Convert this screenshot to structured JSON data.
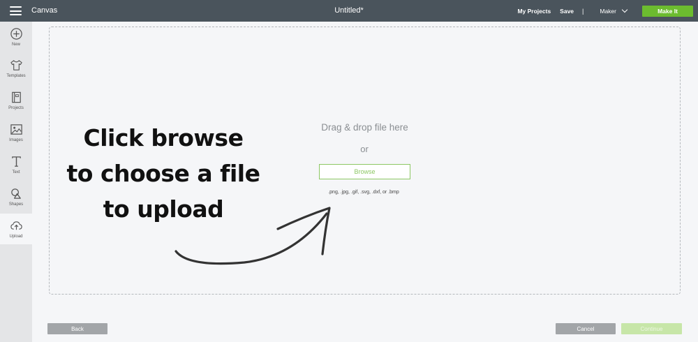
{
  "header": {
    "app_name": "Canvas",
    "doc_title": "Untitled*",
    "my_projects": "My Projects",
    "save": "Save",
    "separator": "|",
    "machine": "Maker",
    "make_it": "Make It"
  },
  "sidebar": {
    "items": [
      {
        "label": "New",
        "icon": "plus-circle-icon"
      },
      {
        "label": "Templates",
        "icon": "tshirt-icon"
      },
      {
        "label": "Projects",
        "icon": "book-icon"
      },
      {
        "label": "Images",
        "icon": "image-icon"
      },
      {
        "label": "Text",
        "icon": "text-icon"
      },
      {
        "label": "Shapes",
        "icon": "shapes-icon"
      },
      {
        "label": "Upload",
        "icon": "cloud-upload-icon"
      }
    ],
    "active": "Upload"
  },
  "upload": {
    "drag_text": "Drag & drop file here",
    "or_text": "or",
    "browse_label": "Browse",
    "formats": ".png, .jpg, .gif, .svg, .dxf, or .bmp"
  },
  "annotation": {
    "lines": [
      "Click browse",
      "to choose a file",
      "to upload"
    ]
  },
  "footer": {
    "back": "Back",
    "cancel": "Cancel",
    "continue": "Continue"
  },
  "colors": {
    "topbar": "#4a545c",
    "accent": "#6cbc2f",
    "sidebar": "#e4e5e7"
  }
}
